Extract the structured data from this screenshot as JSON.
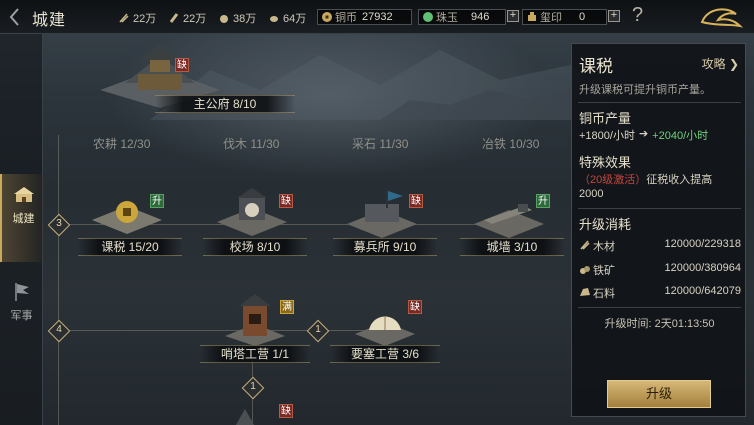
{
  "header": {
    "title": "城建",
    "resources": [
      {
        "icon": "wood-icon",
        "value": "22万"
      },
      {
        "icon": "iron-icon",
        "value": "22万"
      },
      {
        "icon": "stone-icon",
        "value": "38万"
      },
      {
        "icon": "grain-icon",
        "value": "64万"
      }
    ],
    "currencies": [
      {
        "icon": "copper-coin-icon",
        "label": "铜币",
        "value": "27932"
      },
      {
        "icon": "jade-icon",
        "label": "珠玉",
        "value": "946"
      },
      {
        "icon": "seal-icon",
        "label": "玺印",
        "value": "0"
      }
    ],
    "plus": "+",
    "help": "?"
  },
  "sidebar": {
    "tabs": [
      {
        "label": "城建",
        "icon": "city-icon",
        "active": true
      },
      {
        "label": "军事",
        "icon": "flag-icon",
        "active": false
      }
    ]
  },
  "tree": {
    "main": {
      "name": "主公府 8/10",
      "badge": "缺"
    },
    "row2": [
      "农耕 12/30",
      "伐木 11/30",
      "采石 11/30",
      "冶铁 10/30"
    ],
    "tier3": {
      "level": "3",
      "buildings": [
        {
          "name": "课税 15/20",
          "badge": "升"
        },
        {
          "name": "校场 8/10",
          "badge": "缺"
        },
        {
          "name": "募兵所 9/10",
          "badge": "缺"
        },
        {
          "name": "城墙 3/10",
          "badge": "升"
        }
      ]
    },
    "tier4": {
      "level": "4",
      "buildings": [
        {
          "name": "哨塔工营 1/1",
          "badge": "满"
        },
        {
          "name": "要塞工营 3/6",
          "badge": "缺"
        }
      ],
      "link_level": "1",
      "down_level": "1"
    },
    "bottom_badge": "缺"
  },
  "panel": {
    "title": "课税",
    "guide": "攻略",
    "desc": "升级课税可提升铜币产量。",
    "output_title": "铜币产量",
    "output_current": "+1800/小时",
    "output_next": "+2040/小时",
    "effect_title": "特殊效果",
    "effect_req": "（20级激活）",
    "effect_text": "征税收入提高",
    "effect_value": "2000",
    "cost_title": "升级消耗",
    "costs": [
      {
        "icon": "wood-icon",
        "label": "木材",
        "value": "120000/229318"
      },
      {
        "icon": "iron-icon",
        "label": "铁矿",
        "value": "120000/380964"
      },
      {
        "icon": "stone-icon",
        "label": "石料",
        "value": "120000/642079"
      }
    ],
    "time_label": "升级时间:",
    "time_value": "2天01:13:50",
    "upgrade_button": "升级"
  },
  "colors": {
    "accent": "#c9a860",
    "green": "#6fd07a",
    "red": "#c4473d",
    "panel_bg": "#10141a"
  }
}
